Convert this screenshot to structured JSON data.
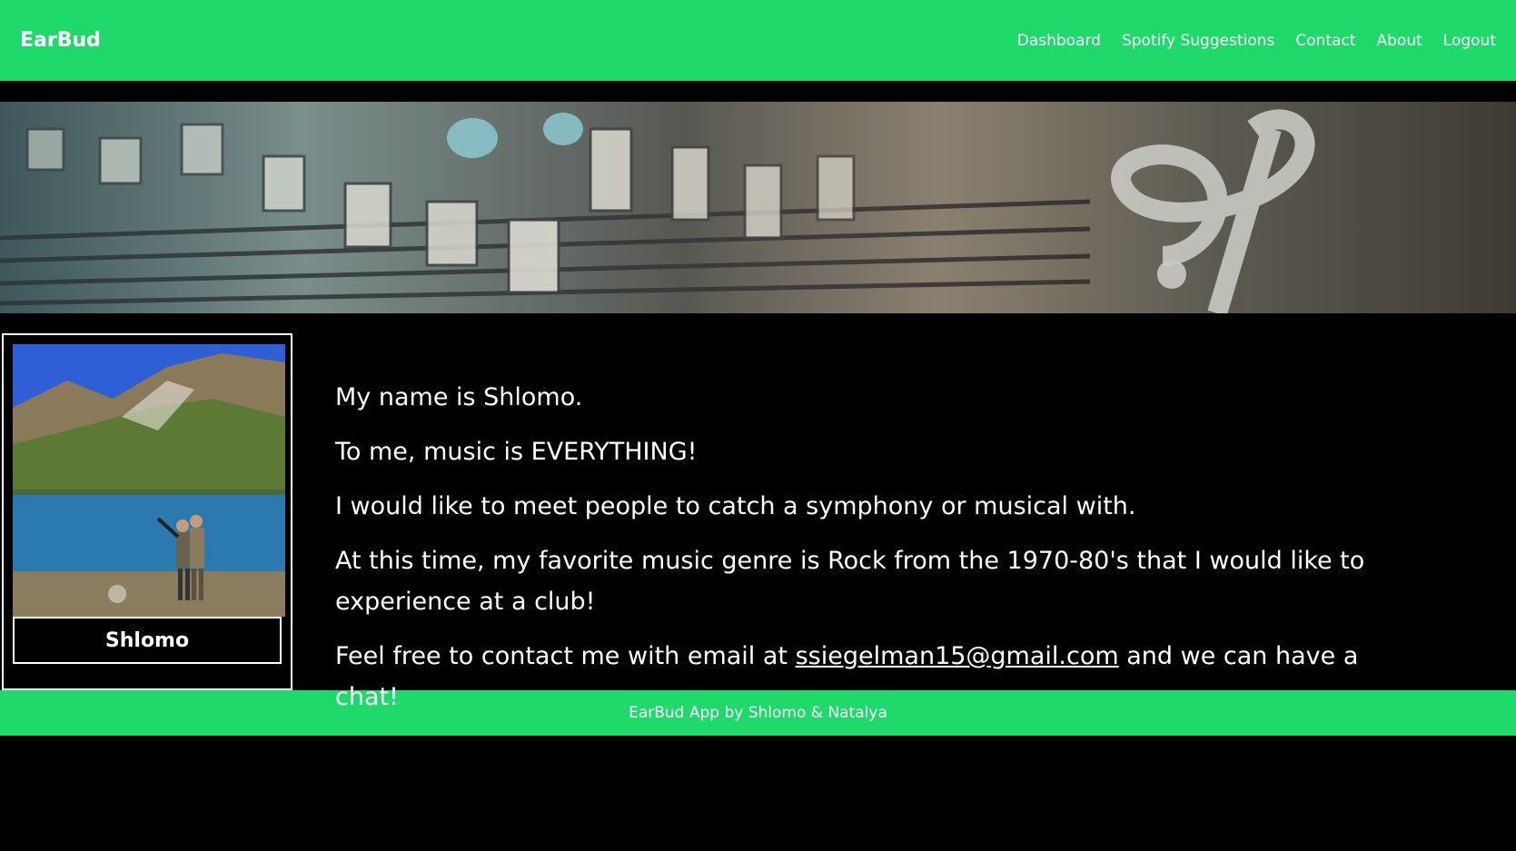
{
  "navbar": {
    "brand": "EarBud",
    "links": [
      "Dashboard",
      "Spotify Suggestions",
      "Contact",
      "About",
      "Logout"
    ]
  },
  "profile": {
    "name": "Shlomo"
  },
  "bio": {
    "line1": "My name is Shlomo.",
    "line2": "To me, music is EVERYTHING!",
    "line3": "I would like to meet people to catch a symphony or musical with.",
    "line4": "At this time, my favorite music genre is Rock from the 1970-80's that I would like to experience at a club!",
    "line5_prefix": "Feel free to contact me with email at ",
    "email": "ssiegelman15@gmail.com",
    "line5_suffix": " and we can have a chat!"
  },
  "footer": {
    "text": "EarBud App by Shlomo & Natalya"
  },
  "colors": {
    "accent": "#1fd96a",
    "background": "#000000",
    "text": "#ffffff"
  }
}
